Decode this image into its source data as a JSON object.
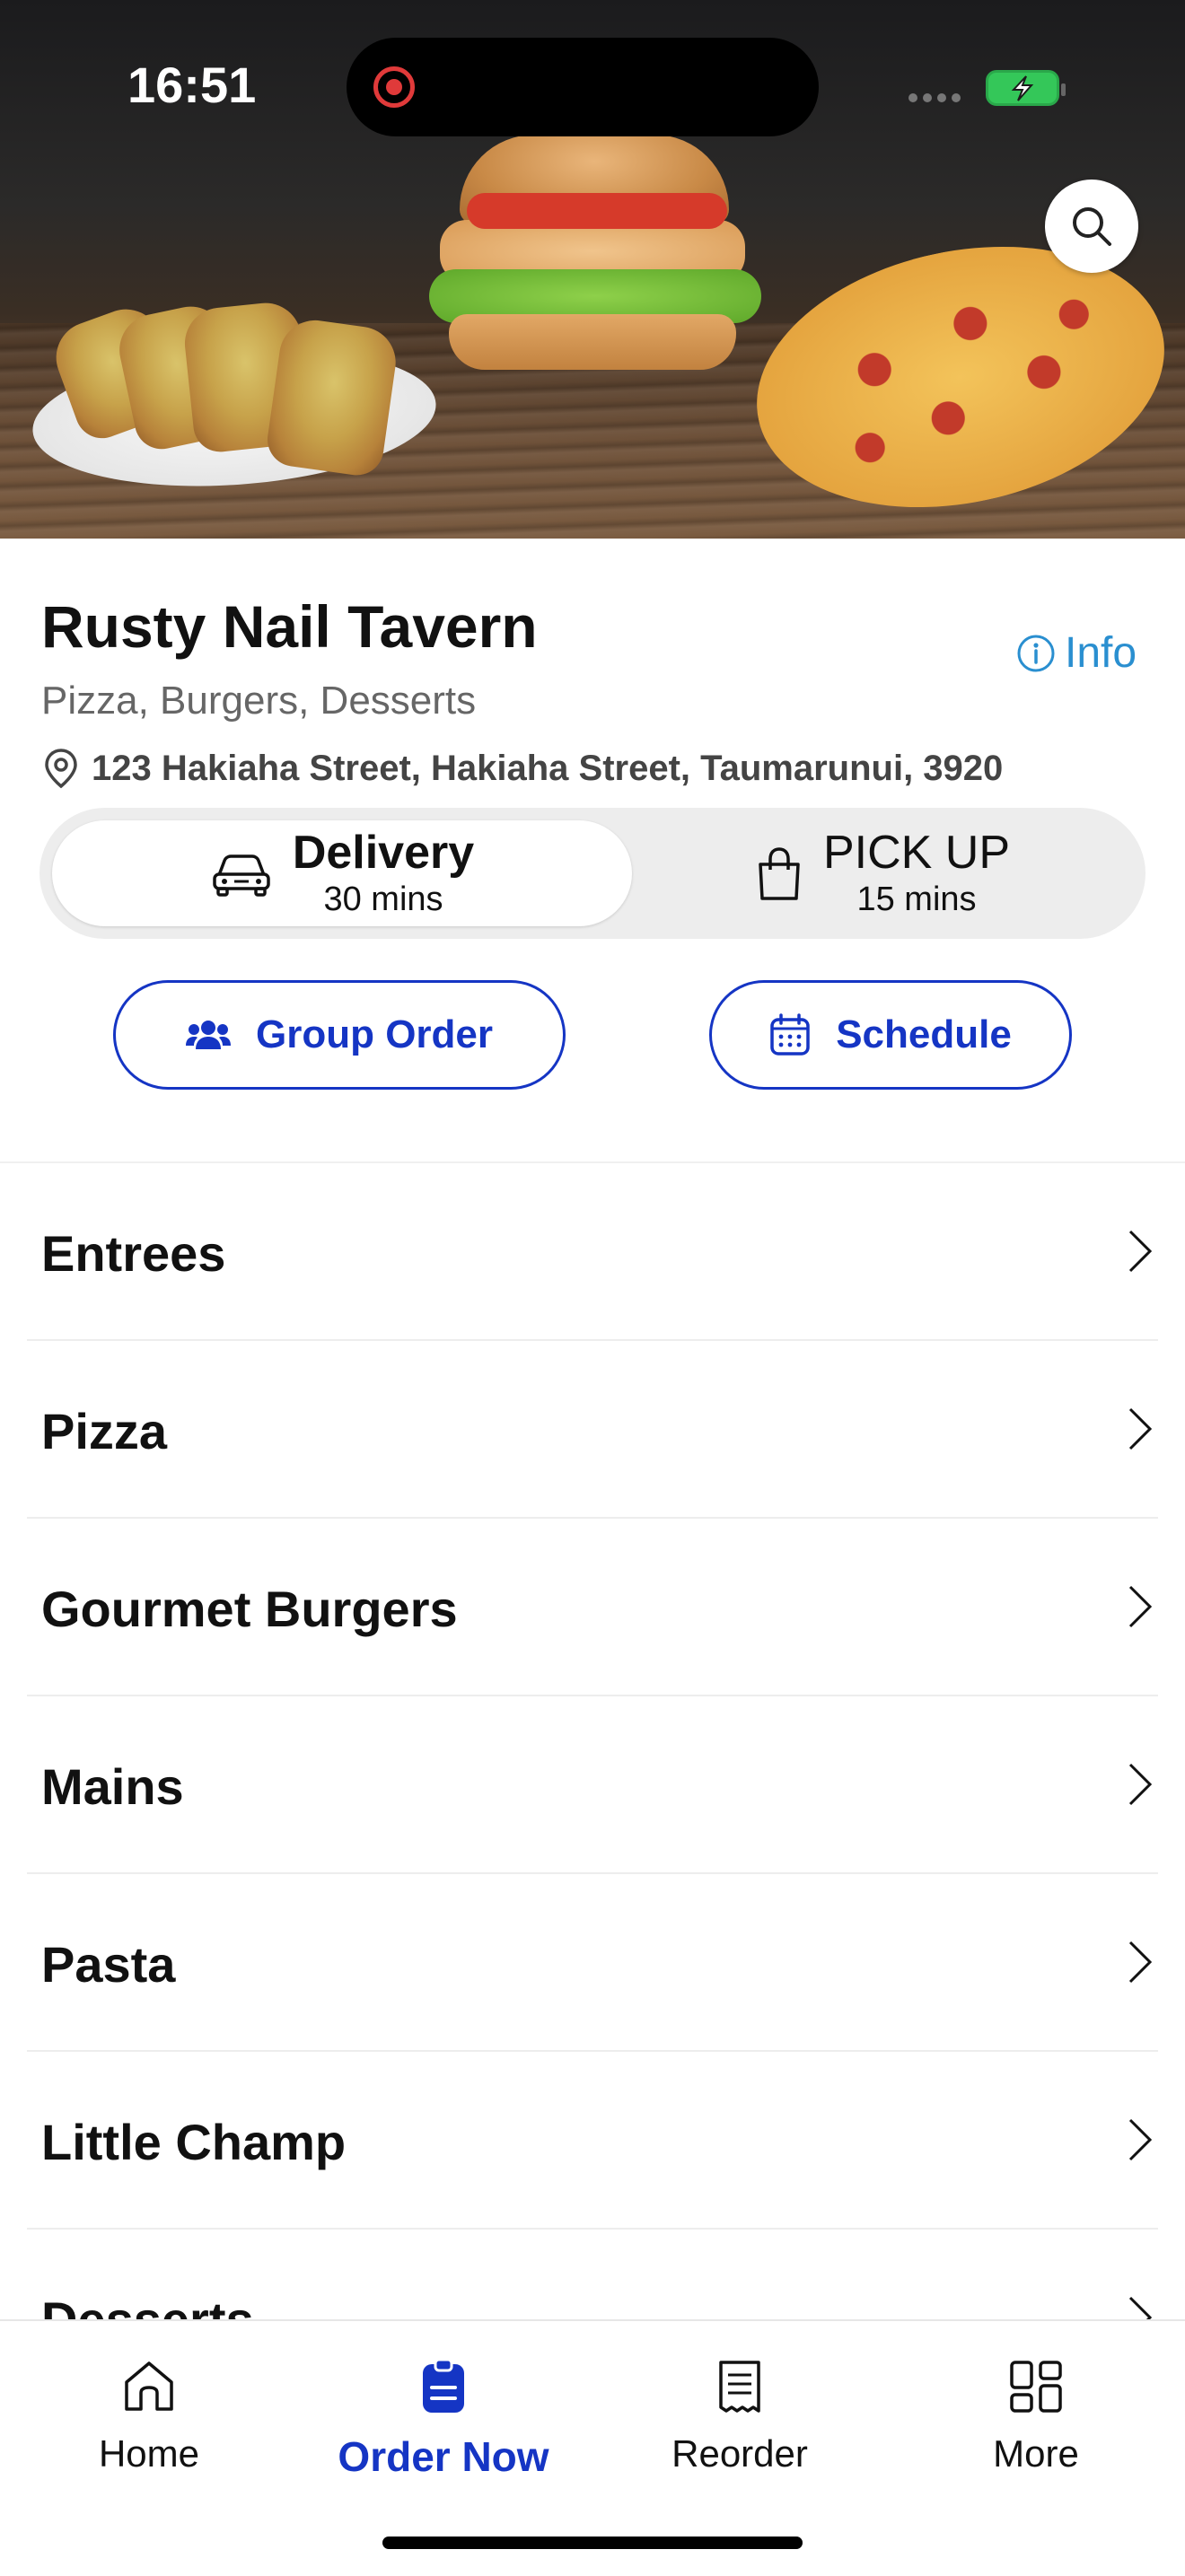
{
  "status_bar": {
    "time": "16:51"
  },
  "restaurant": {
    "name": "Rusty Nail Tavern",
    "info_label": "Info",
    "cuisine": "Pizza, Burgers, Desserts",
    "address": "123 Hakiaha Street, Hakiaha Street, Taumarunui, 3920"
  },
  "order_mode": {
    "selected": "Delivery",
    "options": [
      {
        "label": "Delivery",
        "time": "30 mins",
        "icon": "car-icon"
      },
      {
        "label": "PICK UP",
        "time": "15 mins",
        "icon": "shopping-bag-icon"
      }
    ]
  },
  "actions": {
    "group_order": "Group Order",
    "schedule": "Schedule"
  },
  "menu": {
    "categories": [
      "Entrees",
      "Pizza",
      "Gourmet Burgers",
      "Mains",
      "Pasta",
      "Little Champ",
      "Desserts"
    ]
  },
  "tabbar": {
    "active": "Order Now",
    "tabs": [
      {
        "label": "Home",
        "icon": "home-icon"
      },
      {
        "label": "Order Now",
        "icon": "order-icon"
      },
      {
        "label": "Reorder",
        "icon": "receipt-icon"
      },
      {
        "label": "More",
        "icon": "grid-icon"
      }
    ]
  },
  "colors": {
    "accent": "#1535c4",
    "info": "#2a8fd0",
    "recording": "#e03a3a",
    "battery": "#34c759"
  }
}
